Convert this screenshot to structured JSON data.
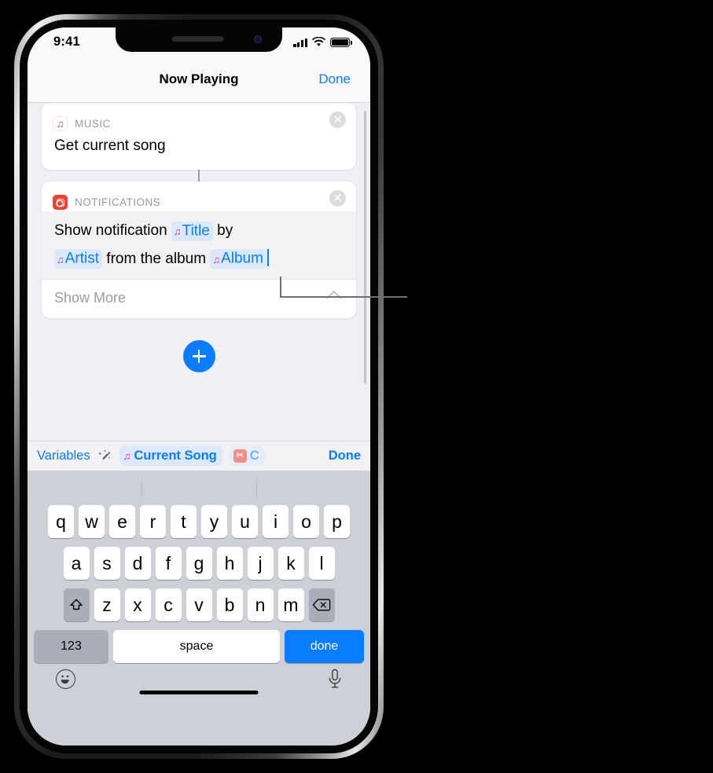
{
  "status_bar": {
    "time": "9:41",
    "cellular_icon": "signal-bars-icon",
    "wifi_icon": "wifi-icon",
    "battery_icon": "battery-icon"
  },
  "nav_bar": {
    "title": "Now Playing",
    "done_label": "Done"
  },
  "actions": [
    {
      "app_name": "MUSIC",
      "app_icon": "music-app-icon",
      "title": "Get current song",
      "close_icon": "close-circle-icon"
    },
    {
      "app_name": "NOTIFICATIONS",
      "app_icon": "notifications-app-icon",
      "close_icon": "close-circle-icon",
      "text_segments": [
        {
          "type": "text",
          "value": "Show notification "
        },
        {
          "type": "token",
          "value": "Title",
          "icon": "music-note-icon"
        },
        {
          "type": "text",
          "value": " by"
        },
        {
          "type": "break"
        },
        {
          "type": "token",
          "value": "Artist",
          "icon": "music-note-icon"
        },
        {
          "type": "text",
          "value": " from the album "
        },
        {
          "type": "token",
          "value": "Album",
          "icon": "music-note-icon"
        }
      ],
      "show_more_label": "Show More",
      "chevron_icon": "chevron-up-icon"
    }
  ],
  "add_action": {
    "icon": "plus-icon",
    "accent_color": "#0a7cff"
  },
  "variables_bar": {
    "label": "Variables",
    "wand_icon": "magic-wand-icon",
    "chips": [
      {
        "label": "Current Song",
        "icon": "music-note-icon"
      },
      {
        "label": "C",
        "icon": "scissors-icon"
      }
    ],
    "done_label": "Done"
  },
  "keyboard": {
    "predictive": [
      "",
      "",
      ""
    ],
    "row1": [
      "q",
      "w",
      "e",
      "r",
      "t",
      "y",
      "u",
      "i",
      "o",
      "p"
    ],
    "row2": [
      "a",
      "s",
      "d",
      "f",
      "g",
      "h",
      "j",
      "k",
      "l"
    ],
    "row3": [
      "z",
      "x",
      "c",
      "v",
      "b",
      "n",
      "m"
    ],
    "shift_icon": "shift-icon",
    "backspace_icon": "backspace-icon",
    "numbers_label": "123",
    "space_label": "space",
    "return_label": "done",
    "emoji_icon": "emoji-icon",
    "dictation_icon": "microphone-icon"
  },
  "colors": {
    "accent": "#0a7cff",
    "token_bg": "#d9e9fb",
    "notification_red": "#f73f30",
    "page_bg": "#efeff4"
  }
}
